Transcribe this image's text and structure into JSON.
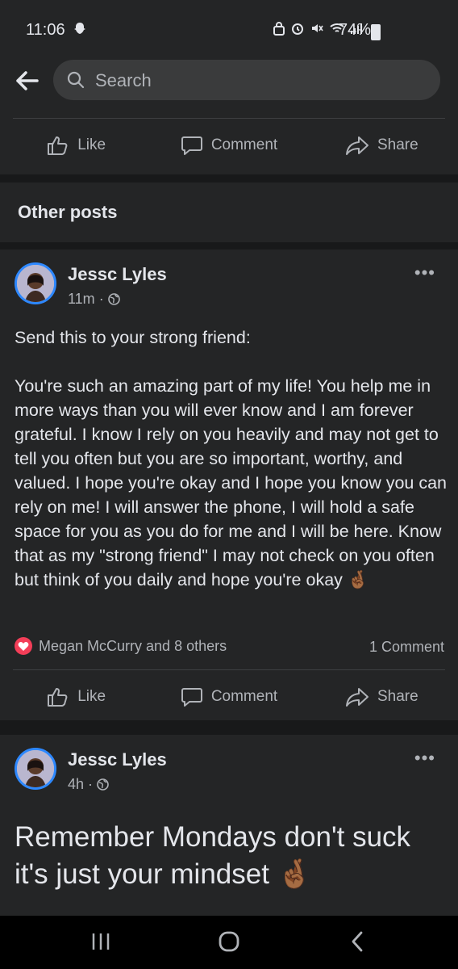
{
  "status_bar": {
    "time": "11:06",
    "battery": "74%"
  },
  "search": {
    "placeholder": "Search"
  },
  "actions": {
    "like": "Like",
    "comment": "Comment",
    "share": "Share"
  },
  "section": {
    "title": "Other posts"
  },
  "posts": [
    {
      "author": "Jessc Lyles",
      "time": "11m",
      "more": "•••",
      "text": "Send this to your strong friend:\n\nYou're such an amazing part of my life! You help me in more ways than you will ever know and I am forever grateful. I know I rely on you heavily and may not get to tell you often but you are so important, worthy, and valued. I hope you're okay and I hope you know you can rely on me! I will answer the phone, I will hold a safe space for you as you do for me and I will be here. Know that as my \"strong friend\" I may not check on you often but think of you daily and hope you're okay",
      "emoji": "🤞🏾",
      "reactions": "Megan McCurry and 8 others",
      "comments": "1 Comment"
    },
    {
      "author": "Jessc Lyles",
      "time": "4h",
      "more": "•••",
      "text": "Remember Mondays don't suck it's just your mindset",
      "emoji": "🤞🏾"
    }
  ],
  "colors": {
    "background": "#18191a",
    "card": "#242526",
    "accent": "#2d88ff",
    "love": "#f33e58",
    "text_secondary": "#b0b3b8"
  }
}
